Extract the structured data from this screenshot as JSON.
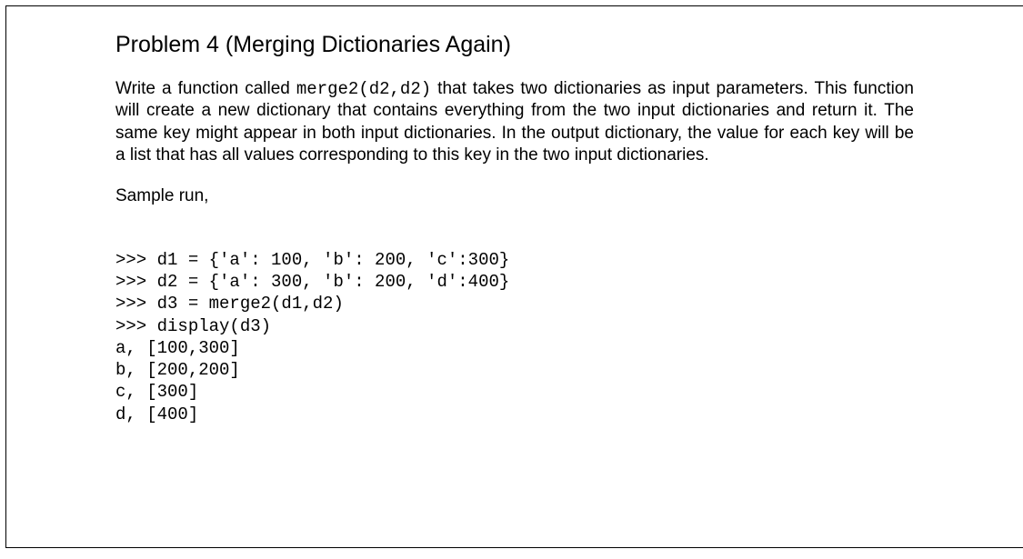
{
  "heading": "Problem 4 (Merging Dictionaries Again)",
  "paragraph_parts": {
    "p1": "Write a function called ",
    "code": "merge2(d2,d2)",
    "p2": " that takes two dictionaries as input parameters. This function will create a new dictionary that contains everything from the two input dictionaries and return it. The same key might appear in both input dictionaries. In the output dictionary, the value for each key will be a list that has all values corresponding to this key in the two input dictionaries."
  },
  "sample_label": "Sample run,",
  "code_lines": [
    ">>> d1 = {'a': 100, 'b': 200, 'c':300}",
    ">>> d2 = {'a': 300, 'b': 200, 'd':400}",
    ">>> d3 = merge2(d1,d2)",
    ">>> display(d3)",
    "a, [100,300]",
    "b, [200,200]",
    "c, [300]",
    "d, [400]"
  ]
}
